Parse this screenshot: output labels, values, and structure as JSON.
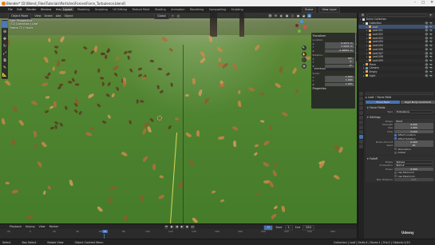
{
  "titlebar": {
    "title": "Blender* [D:\\Blend_Files\\Tutorials\\Particles\\Forces\\Force_Turbulence.blend]"
  },
  "menu": {
    "items": [
      "File",
      "Edit",
      "Render",
      "Window",
      "Help"
    ],
    "workspaces": [
      "Layout",
      "Modeling",
      "Sculpting",
      "UV Editing",
      "Texture Paint",
      "Shading",
      "Animation",
      "Rendering",
      "Compositing",
      "Scripting"
    ],
    "active_workspace": "Layout",
    "scene": "Scene",
    "view_layer": "View Layer"
  },
  "viewport": {
    "mode": "Object Mode",
    "menus": [
      "View",
      "Select",
      "Add",
      "Object"
    ],
    "orientation": "Global",
    "info": [
      "User Perspective",
      "(72) Collection | Leaf",
      "Frame 72 / Hours"
    ]
  },
  "npanel": {
    "transform_header": "Transform",
    "location_label": "Location:",
    "location": [
      [
        "X",
        "0.4271 m"
      ],
      [
        "Y",
        "1.4431 m"
      ],
      [
        "Z",
        "-2.48841 m"
      ]
    ],
    "rotation_label": "Rotation:",
    "rotation": [
      [
        "X",
        "84°"
      ],
      [
        "Y",
        "0°"
      ],
      [
        "Z",
        "-0°"
      ]
    ],
    "mode": "XYZ Euler",
    "scale_label": "Scale:",
    "scale": [
      [
        "X",
        "1.000"
      ],
      [
        "Y",
        "1.000"
      ],
      [
        "Z",
        "1.000"
      ]
    ],
    "properties_header": "Properties"
  },
  "timeline": {
    "menus": [
      "Playback",
      "Keying",
      "View",
      "Marker"
    ],
    "ticks": [
      "-20",
      "0",
      "20",
      "40",
      "60",
      "80",
      "100",
      "120",
      "140",
      "160",
      "180",
      "200",
      "220",
      "240",
      "260"
    ],
    "current_frame": "72",
    "start_label": "Start",
    "start": "1",
    "end_label": "End",
    "end": "250"
  },
  "statusbar": {
    "select": "Select",
    "box_select": "Box Select",
    "rotate_view": "Rotate View",
    "context_menu": "Object Context Menu",
    "stats": "Collection | Leaf | Verts:4 | Faces:1 | Tris:2 | Objects:1/10"
  },
  "outliner": {
    "search_placeholder": "",
    "items": [
      {
        "label": "Scene Collection",
        "indent": 0,
        "color": "#dddddd",
        "selected": false
      },
      {
        "label": "Collection",
        "indent": 1,
        "color": "#dddddd",
        "selected": false
      },
      {
        "label": "Leaf",
        "indent": 2,
        "color": "#e8a84e",
        "selected": true
      },
      {
        "label": "Leaf.001",
        "indent": 2,
        "color": "#e8a84e",
        "selected": false
      },
      {
        "label": "Leaf.002",
        "indent": 2,
        "color": "#e8a84e",
        "selected": false
      },
      {
        "label": "Leaf.003",
        "indent": 2,
        "color": "#e8a84e",
        "selected": false
      },
      {
        "label": "Leaf.004",
        "indent": 2,
        "color": "#e8a84e",
        "selected": false
      },
      {
        "label": "Leaf.005",
        "indent": 2,
        "color": "#e8a84e",
        "selected": false
      },
      {
        "label": "Leaf.006",
        "indent": 2,
        "color": "#e8a84e",
        "selected": false
      },
      {
        "label": "Leaf.007",
        "indent": 2,
        "color": "#e8a84e",
        "selected": false
      },
      {
        "label": "Leaf.008",
        "indent": 2,
        "color": "#e8a84e",
        "selected": false
      },
      {
        "label": "Leaf.009",
        "indent": 2,
        "color": "#e8a84e",
        "selected": false
      },
      {
        "label": "Plane",
        "indent": 1,
        "color": "#e8a84e",
        "selected": false
      },
      {
        "label": "Camera",
        "indent": 1,
        "color": "#59a1d8",
        "selected": false
      },
      {
        "label": "Empty",
        "indent": 1,
        "color": "#e8a84e",
        "selected": false
      },
      {
        "label": "Light",
        "indent": 1,
        "color": "#e8d24e",
        "selected": false
      }
    ]
  },
  "properties": {
    "object": "Leaf",
    "field_label": "Force Field",
    "tabs": [
      "Force Field",
      "Rigid Body Constraint"
    ],
    "physics_header": "Force Fields",
    "type_label": "Type",
    "type_value": "Turbulence",
    "settings_header": "Settings",
    "shape_label": "Shape",
    "shape_value": "Point",
    "strength_label": "Strength",
    "strength_value": "6.000",
    "size_label": "Size",
    "size_value": "1.000",
    "flow_label": "Flow",
    "flow_value": "0.000",
    "affect_location": "Affect Location",
    "affect_rotation": "Affect Rotation",
    "noise_label": "Noise Amount",
    "noise_value": "0.000",
    "seed_label": "Seed",
    "seed_value": "49",
    "absorption": "Absorption",
    "global": "Global",
    "falloff_header": "Falloff",
    "falloff_shape_label": "Shape",
    "falloff_shape_value": "Sphere",
    "z_direction_label": "Z Direction",
    "z_direction_value": "Both Z",
    "power_label": "Power",
    "power_value": "0.000",
    "use_min": "Use Minimum",
    "use_max": "Use Maximum",
    "max_distance_label": "Max Distance",
    "max_distance_value": "0 m"
  },
  "watermark": "Udemy"
}
